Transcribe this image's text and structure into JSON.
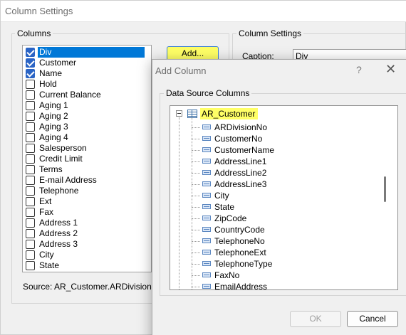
{
  "main": {
    "title": "Column Settings",
    "columns_group_label": "Columns",
    "settings_group_label": "Column Settings",
    "add_button": "Add...",
    "caption_label": "Caption:",
    "caption_value": "Div",
    "source_text": "Source: AR_Customer.ARDivisionNo",
    "columns": [
      {
        "label": "Div",
        "checked": true,
        "selected": true
      },
      {
        "label": "Customer",
        "checked": true
      },
      {
        "label": "Name",
        "checked": true
      },
      {
        "label": "Hold",
        "checked": false
      },
      {
        "label": "Current Balance",
        "checked": false
      },
      {
        "label": "Aging 1",
        "checked": false
      },
      {
        "label": "Aging 2",
        "checked": false
      },
      {
        "label": "Aging 3",
        "checked": false
      },
      {
        "label": "Aging 4",
        "checked": false
      },
      {
        "label": "Salesperson",
        "checked": false
      },
      {
        "label": "Credit Limit",
        "checked": false
      },
      {
        "label": "Terms",
        "checked": false
      },
      {
        "label": "E-mail Address",
        "checked": false
      },
      {
        "label": "Telephone",
        "checked": false
      },
      {
        "label": "Ext",
        "checked": false
      },
      {
        "label": "Fax",
        "checked": false
      },
      {
        "label": "Address 1",
        "checked": false
      },
      {
        "label": "Address 2",
        "checked": false
      },
      {
        "label": "Address 3",
        "checked": false
      },
      {
        "label": "City",
        "checked": false
      },
      {
        "label": "State",
        "checked": false
      }
    ]
  },
  "dialog": {
    "title": "Add Column",
    "help_glyph": "?",
    "close_glyph": "✕",
    "group_label": "Data Source Columns",
    "root_label": "AR_Customer",
    "fields": [
      "ARDivisionNo",
      "CustomerNo",
      "CustomerName",
      "AddressLine1",
      "AddressLine2",
      "AddressLine3",
      "City",
      "State",
      "ZipCode",
      "CountryCode",
      "TelephoneNo",
      "TelephoneExt",
      "TelephoneType",
      "FaxNo",
      "EmailAddress"
    ],
    "ok_label": "OK",
    "cancel_label": "Cancel"
  },
  "colors": {
    "highlight": "#ffff66",
    "selection": "#0078d7",
    "checkbox": "#2a64c5"
  }
}
